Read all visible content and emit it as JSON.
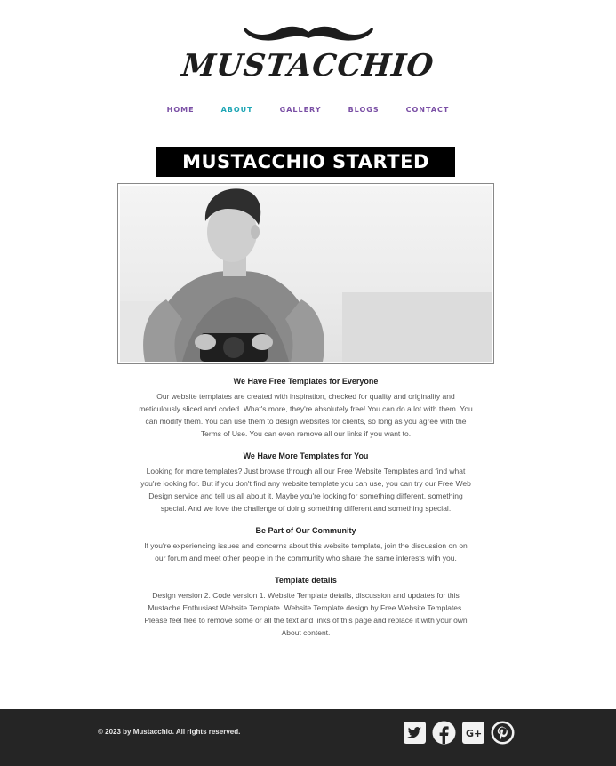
{
  "header": {
    "logo_text": "MUSTACCHIO"
  },
  "nav": {
    "items": [
      {
        "label": "Home"
      },
      {
        "label": "About"
      },
      {
        "label": "Gallery"
      },
      {
        "label": "Blogs"
      },
      {
        "label": "Contact"
      }
    ],
    "active_item": "About",
    "link_color": "#7a4fa5",
    "active_color": "#1ea6b5"
  },
  "main": {
    "title": "MUSTACCHIO STARTED",
    "sections": [
      {
        "heading": "We Have Free Templates for Everyone",
        "body": "Our website templates are created with inspiration, checked for quality and originality and meticulously sliced and coded. What's more, they're absolutely free! You can do a lot with them. You can modify them. You can use them to design websites for clients, so long as you agree with the Terms of Use. You can even remove all our links if you want to."
      },
      {
        "heading": "We Have More Templates for You",
        "body": "Looking for more templates? Just browse through all our Free Website Templates and find what you're looking for. But if you don't find any website template you can use, you can try our Free Web Design service and tell us all about it. Maybe you're looking for something different, something special. And we love the challenge of doing something different and something special."
      },
      {
        "heading": "Be Part of Our Community",
        "body": "If you're experiencing issues and concerns about this website template, join the discussion on on our forum and meet other people in the community who share the same interests with you."
      },
      {
        "heading": "Template details",
        "body": "Design version 2. Code version 1. Website Template details, discussion and updates for this Mustache Enthusiast Website Template. Website Template design by Free Website Templates. Please feel free to remove some or all the text and links of this page and replace it with your own About content."
      }
    ]
  },
  "footer": {
    "copyright": "© 2023 by Mustacchio. All rights reserved.",
    "social_icons": [
      "twitter-icon",
      "facebook-icon",
      "google-plus-icon",
      "pinterest-icon"
    ],
    "background": "#252525"
  }
}
